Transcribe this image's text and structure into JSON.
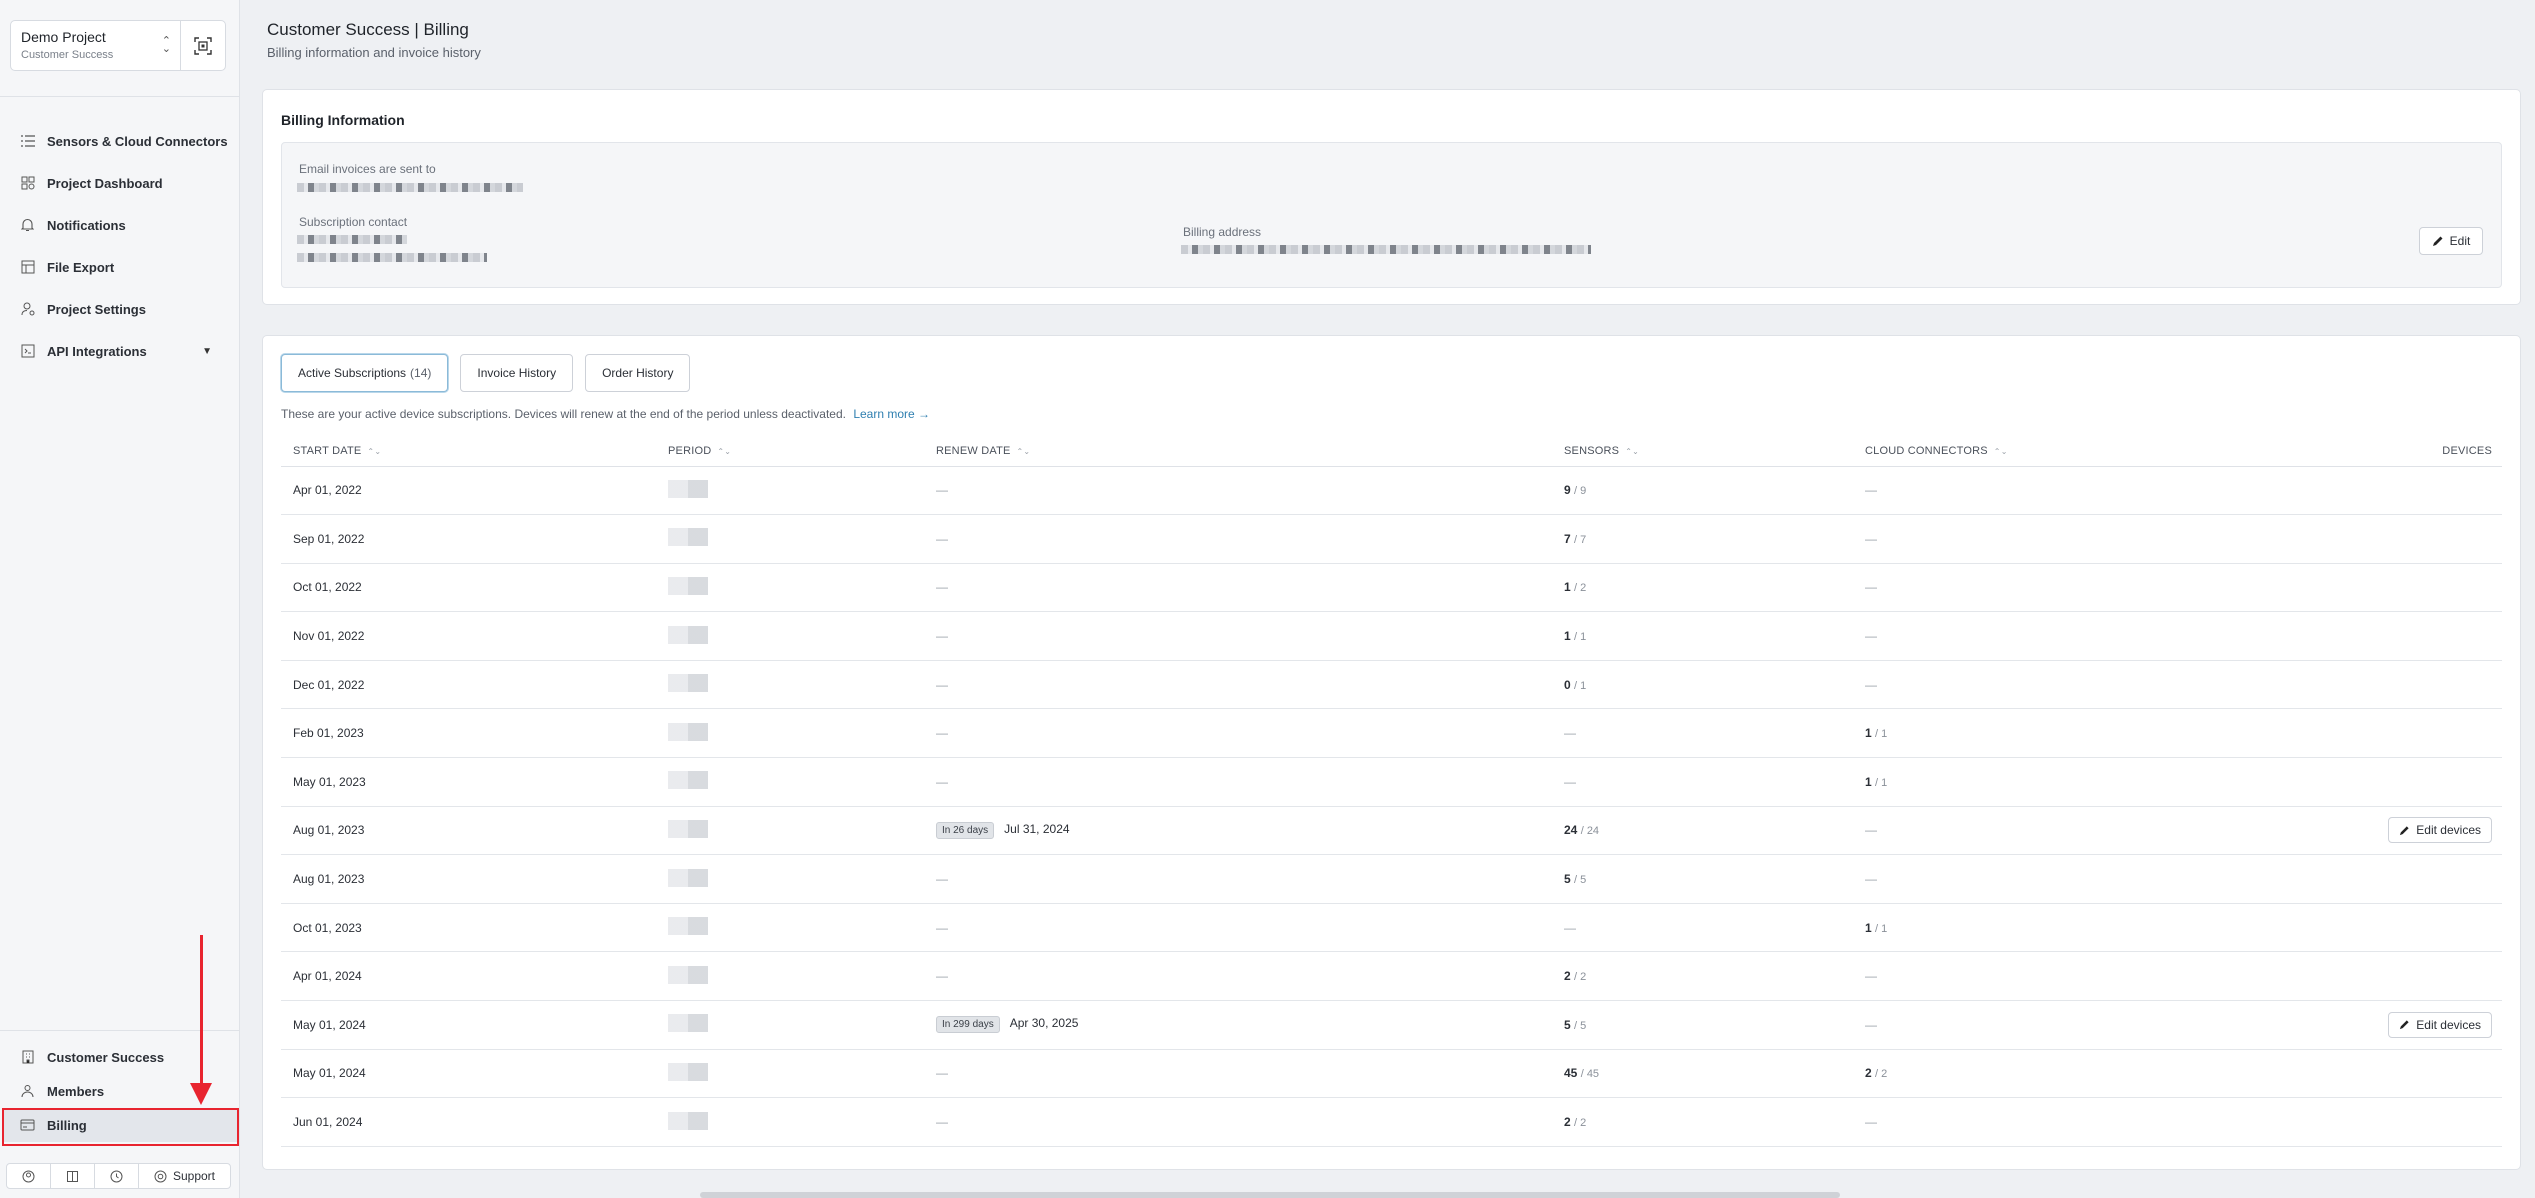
{
  "sidebar": {
    "project": {
      "name": "Demo Project",
      "subtitle": "Customer Success"
    },
    "items": [
      {
        "label": "Sensors & Cloud Connectors",
        "icon": "list-icon"
      },
      {
        "label": "Project Dashboard",
        "icon": "dashboard-icon"
      },
      {
        "label": "Notifications",
        "icon": "bell-icon"
      },
      {
        "label": "File Export",
        "icon": "export-icon"
      },
      {
        "label": "Project Settings",
        "icon": "settings-icon"
      },
      {
        "label": "API Integrations",
        "icon": "api-icon"
      }
    ],
    "bottom_items": [
      {
        "label": "Customer Success",
        "icon": "building-icon"
      },
      {
        "label": "Members",
        "icon": "members-icon"
      },
      {
        "label": "Billing",
        "icon": "card-icon"
      }
    ],
    "support_label": "Support"
  },
  "header": {
    "title": "Customer Success | Billing",
    "subtitle": "Billing information and invoice history"
  },
  "billing_info": {
    "title": "Billing Information",
    "email_label": "Email invoices are sent to",
    "contact_label": "Subscription contact",
    "address_label": "Billing address",
    "edit_label": "Edit"
  },
  "subscriptions": {
    "tabs": [
      {
        "label": "Active Subscriptions",
        "count": "(14)"
      },
      {
        "label": "Invoice History"
      },
      {
        "label": "Order History"
      }
    ],
    "info_text": "These are your active device subscriptions. Devices will renew at the end of the period unless deactivated.",
    "learn_more": "Learn more →",
    "columns": [
      "START DATE",
      "PERIOD",
      "RENEW DATE",
      "SENSORS",
      "CLOUD CONNECTORS",
      "DEVICES"
    ],
    "edit_devices_label": "Edit devices",
    "rows": [
      {
        "start": "Apr 01, 2022",
        "badge": "",
        "renew": "—",
        "s_used": "9",
        "s_total": "/ 9",
        "c_used": "",
        "c_total": "—",
        "edit": false
      },
      {
        "start": "Sep 01, 2022",
        "badge": "",
        "renew": "—",
        "s_used": "7",
        "s_total": "/ 7",
        "c_used": "",
        "c_total": "—",
        "edit": false
      },
      {
        "start": "Oct 01, 2022",
        "badge": "",
        "renew": "—",
        "s_used": "1",
        "s_total": "/ 2",
        "c_used": "",
        "c_total": "—",
        "edit": false
      },
      {
        "start": "Nov 01, 2022",
        "badge": "",
        "renew": "—",
        "s_used": "1",
        "s_total": "/ 1",
        "c_used": "",
        "c_total": "—",
        "edit": false
      },
      {
        "start": "Dec 01, 2022",
        "badge": "",
        "renew": "—",
        "s_used": "0",
        "s_total": "/ 1",
        "c_used": "",
        "c_total": "—",
        "edit": false
      },
      {
        "start": "Feb 01, 2023",
        "badge": "",
        "renew": "—",
        "s_used": "",
        "s_total": "—",
        "c_used": "1",
        "c_total": "/ 1",
        "edit": false
      },
      {
        "start": "May 01, 2023",
        "badge": "",
        "renew": "—",
        "s_used": "",
        "s_total": "—",
        "c_used": "1",
        "c_total": "/ 1",
        "edit": false
      },
      {
        "start": "Aug 01, 2023",
        "badge": "In 26 days",
        "renew": "Jul 31, 2024",
        "s_used": "24",
        "s_total": "/ 24",
        "c_used": "",
        "c_total": "—",
        "edit": true
      },
      {
        "start": "Aug 01, 2023",
        "badge": "",
        "renew": "—",
        "s_used": "5",
        "s_total": "/ 5",
        "c_used": "",
        "c_total": "—",
        "edit": false
      },
      {
        "start": "Oct 01, 2023",
        "badge": "",
        "renew": "—",
        "s_used": "",
        "s_total": "—",
        "c_used": "1",
        "c_total": "/ 1",
        "edit": false
      },
      {
        "start": "Apr 01, 2024",
        "badge": "",
        "renew": "—",
        "s_used": "2",
        "s_total": "/ 2",
        "c_used": "",
        "c_total": "—",
        "edit": false
      },
      {
        "start": "May 01, 2024",
        "badge": "In 299 days",
        "renew": "Apr 30, 2025",
        "s_used": "5",
        "s_total": "/ 5",
        "c_used": "",
        "c_total": "—",
        "edit": true
      },
      {
        "start": "May 01, 2024",
        "badge": "",
        "renew": "—",
        "s_used": "45",
        "s_total": "/ 45",
        "c_used": "2",
        "c_total": "/ 2",
        "edit": false
      },
      {
        "start": "Jun 01, 2024",
        "badge": "",
        "renew": "—",
        "s_used": "2",
        "s_total": "/ 2",
        "c_used": "",
        "c_total": "—",
        "edit": false
      }
    ]
  },
  "colors": {
    "highlight": "#e8242f",
    "link": "#2f7fb0"
  }
}
